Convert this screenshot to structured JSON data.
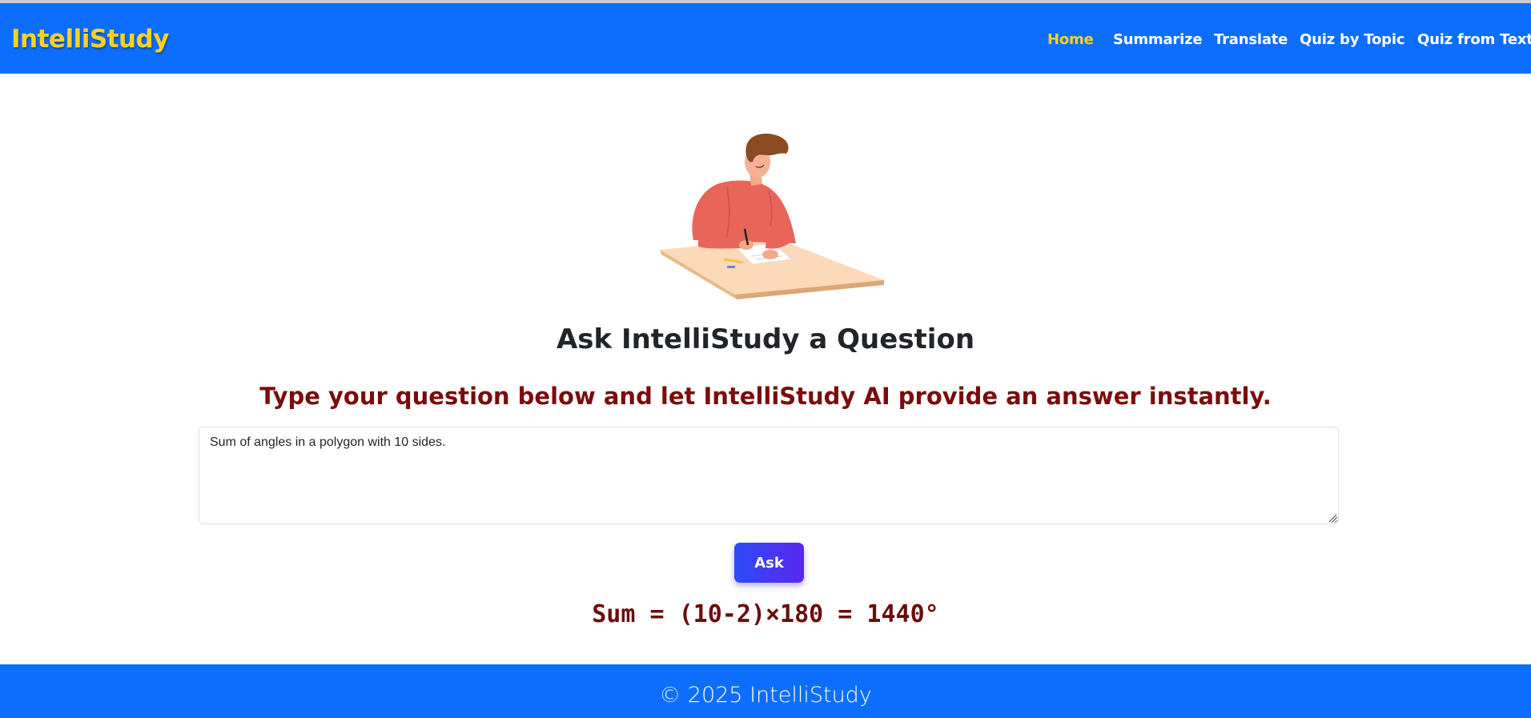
{
  "navbar": {
    "brand": "IntelliStudy",
    "links": [
      "Home",
      "Summarize",
      "Translate",
      "Quiz by Topic",
      "Quiz from Text"
    ],
    "active": "Home"
  },
  "hero": {
    "illustration": "student-writing-at-desk-illustration"
  },
  "main": {
    "title": "Ask IntelliStudy a Question",
    "subtitle": "Type your question below and let IntelliStudy AI provide an answer instantly.",
    "question_value": "Sum of angles in a polygon with 10 sides.",
    "ask_label": "Ask",
    "answer": "Sum = (10-2)×180 = 1440°"
  },
  "footer": {
    "text": "© 2025 IntelliStudy"
  },
  "colors": {
    "primary": "#0d6efd",
    "brand_yellow": "#ffd21f",
    "subtitle_red": "#7a0c0c",
    "answer_red": "#6b0d0d",
    "button_gradient_start": "#2d4cf7",
    "button_gradient_end": "#5a26f0"
  }
}
